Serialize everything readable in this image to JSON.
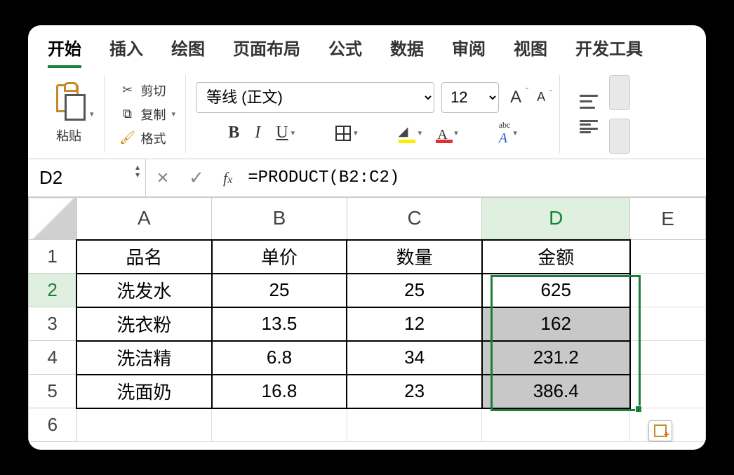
{
  "ribbon": {
    "tabs": [
      "开始",
      "插入",
      "绘图",
      "页面布局",
      "公式",
      "数据",
      "审阅",
      "视图",
      "开发工具"
    ],
    "active_tab": 0,
    "paste_label": "粘贴",
    "cut_label": "剪切",
    "copy_label": "复制",
    "format_label": "格式",
    "font_name": "等线 (正文)",
    "font_size": "12"
  },
  "formula_bar": {
    "name_box": "D2",
    "formula": "=PRODUCT(B2:C2)"
  },
  "sheet": {
    "columns": [
      "A",
      "B",
      "C",
      "D",
      "E"
    ],
    "active_col": "D",
    "active_row": 2,
    "selection": "D2:D5",
    "headers": {
      "A": "品名",
      "B": "单价",
      "C": "数量",
      "D": "金额"
    },
    "rows": [
      {
        "A": "洗发水",
        "B": "25",
        "C": "25",
        "D": "625"
      },
      {
        "A": "洗衣粉",
        "B": "13.5",
        "C": "12",
        "D": "162"
      },
      {
        "A": "洗洁精",
        "B": "6.8",
        "C": "34",
        "D": "231.2"
      },
      {
        "A": "洗面奶",
        "B": "16.8",
        "C": "23",
        "D": "386.4"
      }
    ]
  },
  "chart_data": {
    "type": "table",
    "columns": [
      "品名",
      "单价",
      "数量",
      "金额"
    ],
    "data": [
      [
        "洗发水",
        25,
        25,
        625
      ],
      [
        "洗衣粉",
        13.5,
        12,
        162
      ],
      [
        "洗洁精",
        6.8,
        34,
        231.2
      ],
      [
        "洗面奶",
        16.8,
        23,
        386.4
      ]
    ]
  }
}
